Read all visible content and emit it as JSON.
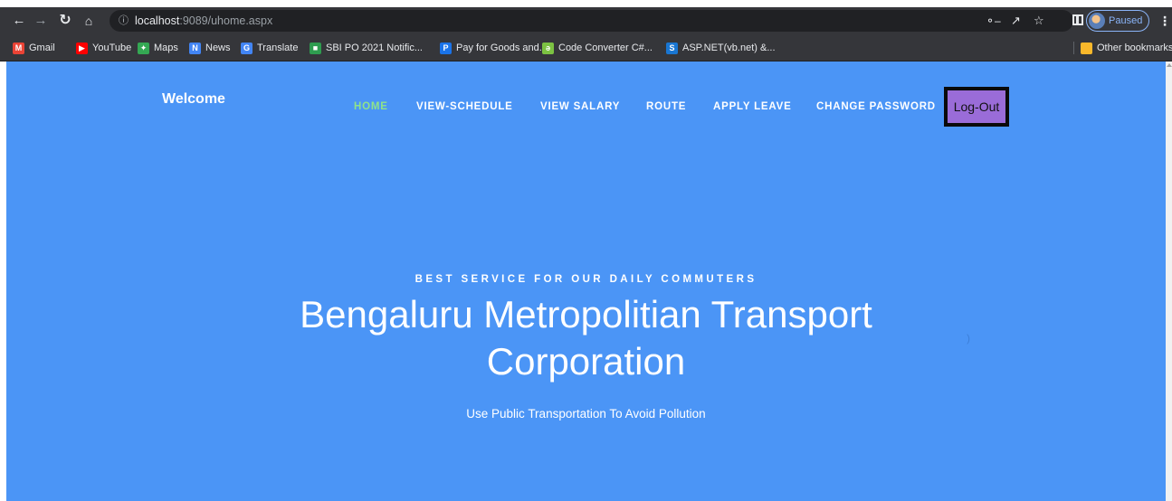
{
  "browser": {
    "address": {
      "host": "localhost",
      "port_path": ":9089/uhome.aspx"
    },
    "profile_label": "Paused",
    "bookmarks": [
      {
        "label": "Gmail",
        "icon": "gmail-icon",
        "color": "#ea4335"
      },
      {
        "label": "YouTube",
        "icon": "youtube-icon",
        "color": "#ff0000"
      },
      {
        "label": "Maps",
        "icon": "maps-icon",
        "color": "#34a853"
      },
      {
        "label": "News",
        "icon": "news-icon",
        "color": "#4285f4"
      },
      {
        "label": "Translate",
        "icon": "translate-icon",
        "color": "#4285f4"
      },
      {
        "label": "SBI PO 2021 Notific...",
        "icon": "sbi-icon",
        "color": "#2e9c4f"
      },
      {
        "label": "Pay for Goods and...",
        "icon": "paypal-icon",
        "color": "#1a73e8"
      },
      {
        "label": "Code Converter C#...",
        "icon": "converter-icon",
        "color": "#7cc242"
      },
      {
        "label": "ASP.NET(vb.net) &...",
        "icon": "asp-icon",
        "color": "#1976d2"
      }
    ],
    "other_bookmarks": "Other bookmarks"
  },
  "site": {
    "brand": "Welcome",
    "nav": [
      "HOME",
      "VIEW-SCHEDULE",
      "VIEW SALARY",
      "ROUTE",
      "APPLY LEAVE",
      "CHANGE PASSWORD"
    ],
    "logout": "Log-Out",
    "accent_color": "#4b95f6",
    "active_nav_color": "#8fe38a"
  },
  "hero": {
    "eyebrow": "BEST SERVICE FOR OUR DAILY COMMUTERS",
    "title_line1": "Bengaluru Metropolitian Transport",
    "title_line2": "Corporation",
    "tagline": "Use Public Transportation To Avoid Pollution",
    "stray_mark": ")"
  }
}
